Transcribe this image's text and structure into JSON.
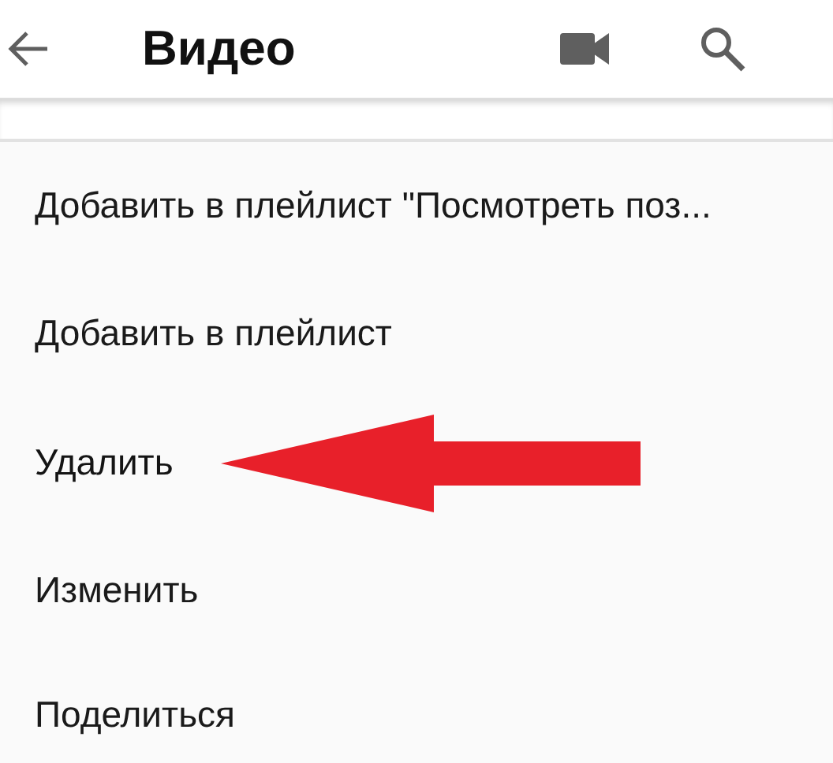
{
  "app_bar": {
    "title": "Видео"
  },
  "menu": {
    "items": [
      {
        "label": "Добавить в плейлист \"Посмотреть поз...",
        "highlighted": false
      },
      {
        "label": "Добавить в плейлист",
        "highlighted": false
      },
      {
        "label": "Удалить",
        "highlighted": true
      },
      {
        "label": "Изменить",
        "highlighted": false
      },
      {
        "label": "Поделиться",
        "highlighted": false
      }
    ]
  }
}
